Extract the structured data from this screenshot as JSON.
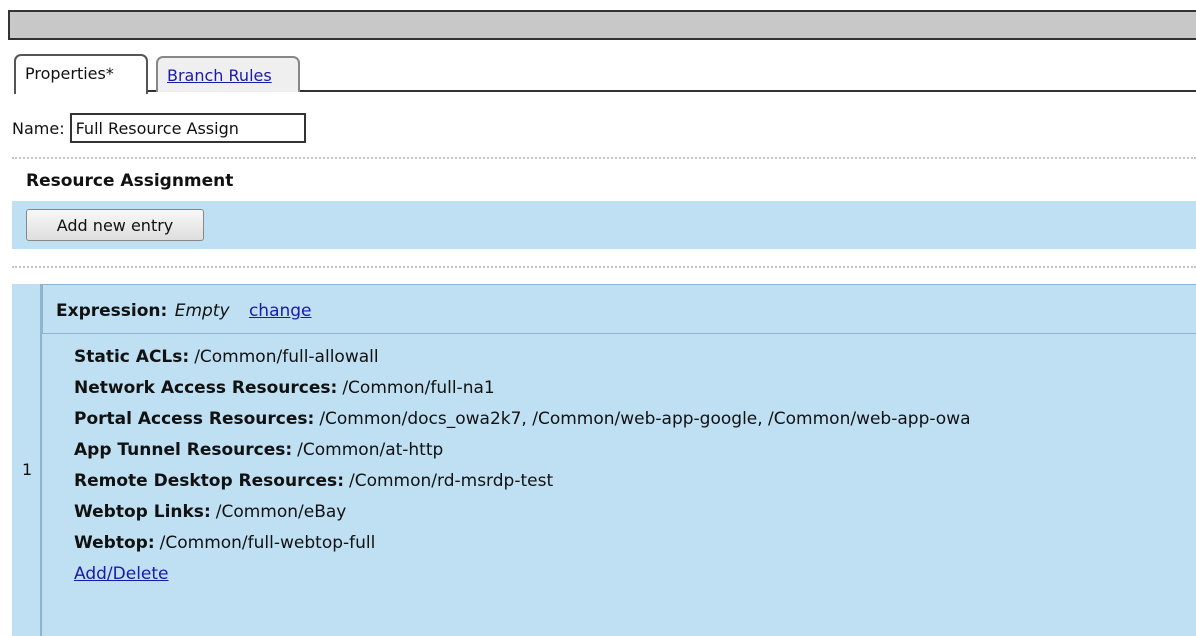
{
  "tabs": [
    {
      "label": "Properties*",
      "active": true
    },
    {
      "label": "Branch Rules",
      "active": false
    }
  ],
  "name_field": {
    "label": "Name:",
    "value": "Full Resource Assign"
  },
  "section": {
    "title": "Resource Assignment"
  },
  "add_button": {
    "label": "Add new entry"
  },
  "entry": {
    "index": "1",
    "expression": {
      "key": "Expression:",
      "value": "Empty",
      "link": "change"
    },
    "fields": [
      {
        "key": "Static ACLs",
        "value": "/Common/full-allowall"
      },
      {
        "key": "Network Access Resources",
        "value": "/Common/full-na1"
      },
      {
        "key": "Portal Access Resources",
        "value": "/Common/docs_owa2k7, /Common/web-app-google, /Common/web-app-owa"
      },
      {
        "key": "App Tunnel Resources",
        "value": "/Common/at-http"
      },
      {
        "key": "Remote Desktop Resources",
        "value": "/Common/rd-msrdp-test"
      },
      {
        "key": "Webtop Links",
        "value": "/Common/eBay"
      },
      {
        "key": "Webtop",
        "value": "/Common/full-webtop-full"
      }
    ],
    "add_delete_link": "Add/Delete"
  },
  "colors": {
    "panel_bg": "#bfe0f3",
    "link": "#1a1aa8",
    "titlebar": "#c8c8c8"
  }
}
